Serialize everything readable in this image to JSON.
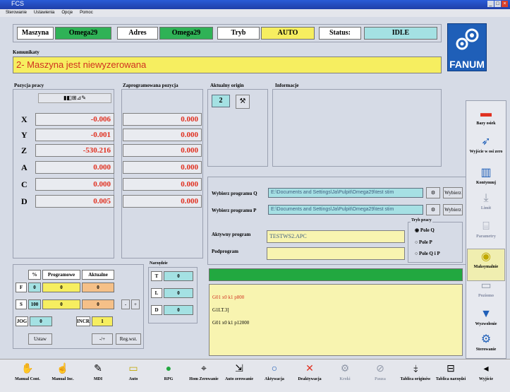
{
  "window": {
    "title": "FCS",
    "min": "_",
    "max": "□",
    "close": "×"
  },
  "menu": [
    "Sterowanie",
    "Ustawienia",
    "Opcje",
    "Pomoc"
  ],
  "status": {
    "machine_label": "Maszyna",
    "machine_value": "Omega29",
    "address_label": "Adres",
    "address_value": "Omega29",
    "mode_label": "Tryb",
    "mode_value": "AUTO",
    "status_label": "Status:",
    "status_value": "IDLE"
  },
  "brand": "FANUM",
  "messages": {
    "label": "Komunikaty",
    "text": "2- Maszyna jest niewyzerowana"
  },
  "work_position": {
    "label": "Pozycja pracy",
    "axes": [
      {
        "name": "X",
        "value": "-0.006"
      },
      {
        "name": "Y",
        "value": "-0.001"
      },
      {
        "name": "Z",
        "value": "-530.216"
      },
      {
        "name": "A",
        "value": "0.000"
      },
      {
        "name": "C",
        "value": "0.000"
      },
      {
        "name": "D",
        "value": "0.005"
      }
    ]
  },
  "programmed_position": {
    "label": "Zaprogramowana pozycja",
    "values": [
      "0.000",
      "0.000",
      "0.000",
      "0.000",
      "0.000",
      "0.000"
    ]
  },
  "current_origin": {
    "label": "Aktualny origin",
    "value": "2"
  },
  "info": {
    "label": "Informacje"
  },
  "programs": {
    "q_label": "Wybierz programu Q",
    "q_path": "E:\\Documents and Settings\\Ja\\Pulpit\\Omega29\\test stim",
    "p_label": "Wybierz programu P",
    "p_path": "E:\\Documents and Settings\\Ja\\Pulpit\\Omega29\\test stim",
    "browse": "Wybierz",
    "active_label": "Aktywny program",
    "active_value": "TESTWS2.APC",
    "sub_label": "Podprogram",
    "sub_value": ""
  },
  "work_field": {
    "label": "Tryb pracy",
    "options": [
      "Pole Q",
      "Pole P",
      "Pole Q i P"
    ],
    "selected": 0
  },
  "code_lines": [
    "G01 x0 k1 p800",
    "G1LT.3]",
    "G01 x0 k1 p12000"
  ],
  "overrides": {
    "col_pct": "%",
    "col_prog": "Programowe",
    "col_act": "Aktualne",
    "rows": [
      {
        "k": "F",
        "pct": "0",
        "prog": "0",
        "act": "0"
      },
      {
        "k": "S",
        "pct": "100",
        "prog": "0",
        "act": "0"
      }
    ],
    "jog_label": "JOG",
    "jog_value": "0",
    "inc_label": "INCR",
    "inc_value": "1",
    "minus": "-",
    "plus": "+",
    "btn_left": "Ustaw",
    "btn_mid": "-/+",
    "btn_right": "Reg.wst."
  },
  "tools": {
    "label": "Narzędzie",
    "rows": [
      {
        "k": "T",
        "v": "0"
      },
      {
        "k": "L",
        "v": "0"
      },
      {
        "k": "D",
        "v": "0"
      }
    ]
  },
  "side_buttons": [
    "Bazy osiek",
    "Wyjście w osi zero",
    "Kontynuuj",
    "Limit",
    "Parametry",
    "Maksymalnie",
    "Poziomo",
    "Wyzwolenie",
    "Sterowanie"
  ],
  "toolbar": [
    "Manual Cont.",
    "Manual Inc.",
    "MDI",
    "Auto",
    "RPG",
    "Hom Zerowanie",
    "Auto zerowanie",
    "Aktywacja",
    "Deaktywacja",
    "Kroki",
    "Pauza",
    "Tablica originów",
    "Tablica narzędzi",
    "Wyjście"
  ],
  "colors": {
    "green": "#2fb256",
    "cyan": "#a4e1e3",
    "yellow": "#f6ee60",
    "orange": "#f5c088",
    "blue_logo": "#1f5fb8",
    "status_green": "#22a840"
  }
}
